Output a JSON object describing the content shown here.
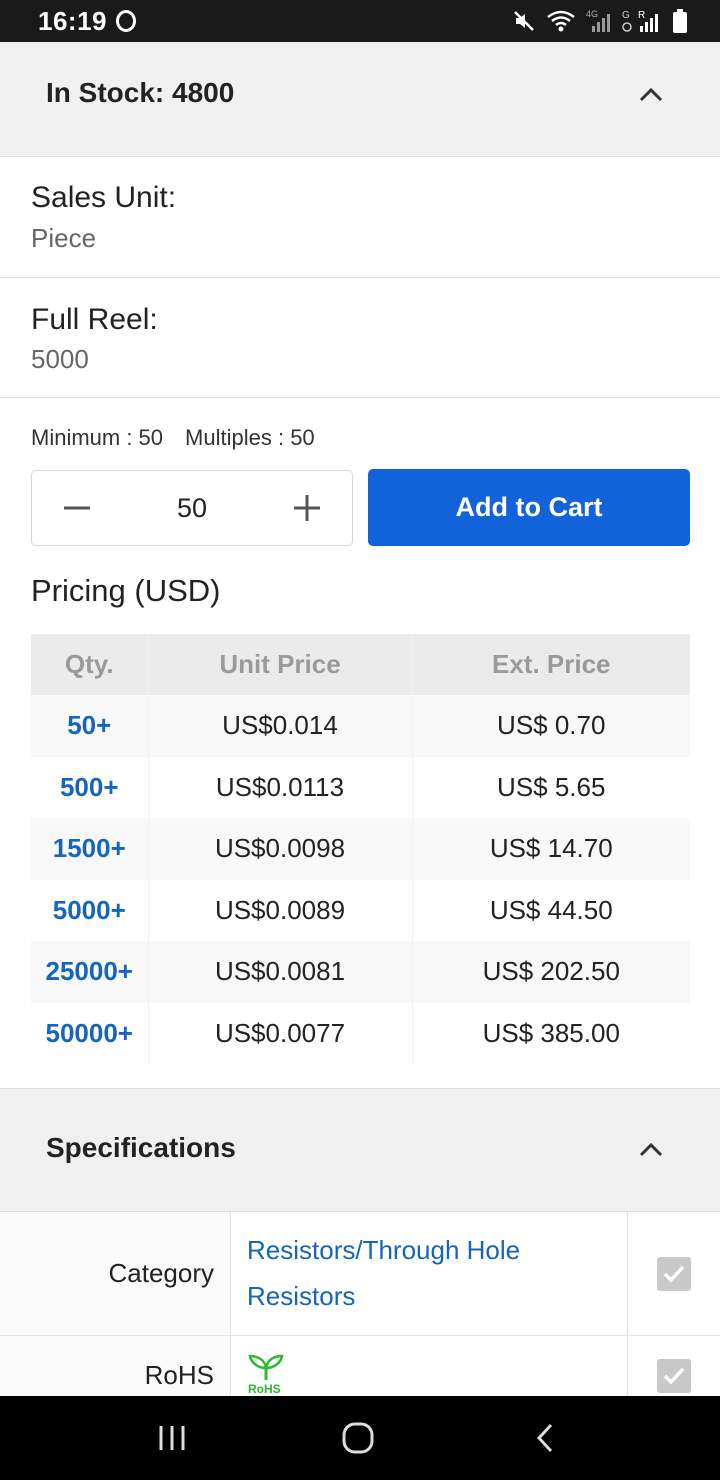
{
  "status_bar": {
    "time": "16:19",
    "icons": [
      "mute-icon",
      "wifi-icon",
      "signal-icon",
      "signal-icon",
      "battery-icon"
    ]
  },
  "stock_section": {
    "title": "In Stock: 4800",
    "expanded": true
  },
  "sales_unit": {
    "label": "Sales Unit:",
    "value": "Piece"
  },
  "full_reel": {
    "label": "Full Reel:",
    "value": "5000"
  },
  "order_rules": {
    "minimum": "Minimum : 50",
    "multiples": "Multiples : 50"
  },
  "quantity": {
    "value": "50"
  },
  "add_to_cart": {
    "label": "Add to Cart",
    "color": "#1262d9"
  },
  "pricing": {
    "title": "Pricing (USD)",
    "headers": [
      "Qty.",
      "Unit Price",
      "Ext. Price"
    ],
    "rows": [
      {
        "qty": "50+",
        "unit": "US$0.014",
        "ext": "US$ 0.70"
      },
      {
        "qty": "500+",
        "unit": "US$0.0113",
        "ext": "US$ 5.65"
      },
      {
        "qty": "1500+",
        "unit": "US$0.0098",
        "ext": "US$ 14.70"
      },
      {
        "qty": "5000+",
        "unit": "US$0.0089",
        "ext": "US$ 44.50"
      },
      {
        "qty": "25000+",
        "unit": "US$0.0081",
        "ext": "US$ 202.50"
      },
      {
        "qty": "50000+",
        "unit": "US$0.0077",
        "ext": "US$ 385.00"
      }
    ]
  },
  "specifications": {
    "title": "Specifications",
    "expanded": true,
    "rows": [
      {
        "label": "Category",
        "links": [
          "Resistors/Through Hole",
          "Resistors"
        ]
      },
      {
        "label": "RoHS",
        "badge": "RoHS"
      }
    ]
  },
  "colors": {
    "accent": "#1262d9",
    "link": "#1565c0",
    "rohs": "#2eb82e"
  }
}
